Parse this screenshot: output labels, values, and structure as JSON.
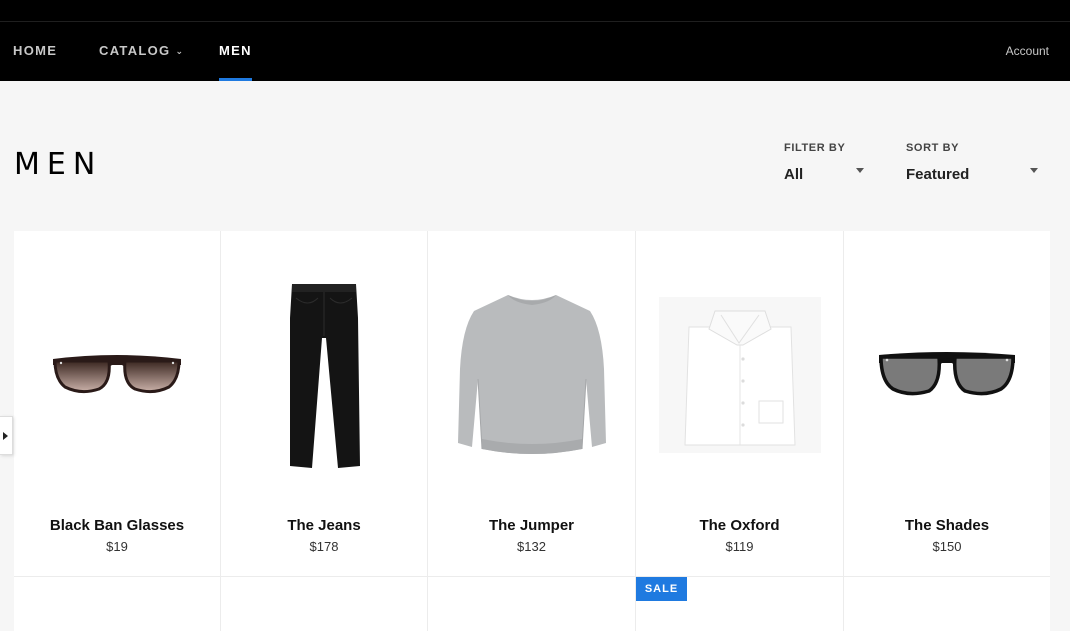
{
  "nav": {
    "items": [
      {
        "label": "HOME"
      },
      {
        "label": "CATALOG"
      },
      {
        "label": "MEN"
      }
    ],
    "account_label": "Account"
  },
  "page": {
    "title": "MEN"
  },
  "filters": {
    "filter_by": {
      "label": "FILTER BY",
      "value": "All"
    },
    "sort_by": {
      "label": "SORT BY",
      "value": "Featured"
    }
  },
  "products": [
    {
      "name": "Black Ban Glasses",
      "price": "$19"
    },
    {
      "name": "The Jeans",
      "price": "$178"
    },
    {
      "name": "The Jumper",
      "price": "$132"
    },
    {
      "name": "The Oxford",
      "price": "$119"
    },
    {
      "name": "The Shades",
      "price": "$150"
    }
  ],
  "badges": {
    "sale_label": "SALE"
  },
  "colors": {
    "accent": "#1f7ae0",
    "nav_background": "#000000",
    "page_background": "#f6f6f6"
  }
}
